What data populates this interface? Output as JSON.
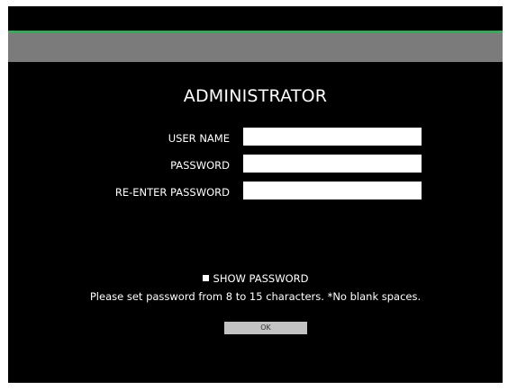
{
  "page": {
    "title": "ADMINISTRATOR"
  },
  "form": {
    "fields": [
      {
        "label": "USER NAME",
        "value": "",
        "placeholder": ""
      },
      {
        "label": "PASSWORD",
        "value": "",
        "placeholder": ""
      },
      {
        "label": "RE-ENTER PASSWORD",
        "value": "",
        "placeholder": ""
      }
    ],
    "show_password": {
      "label": "SHOW PASSWORD",
      "checked": false
    },
    "note": "Please set password from 8 to 15 characters. *No blank spaces.",
    "ok_label": "OK"
  },
  "colors": {
    "background": "#000000",
    "header_bar": "#7b7b7b",
    "header_accent": "#3fa45c",
    "button": "#c3c3c3"
  }
}
